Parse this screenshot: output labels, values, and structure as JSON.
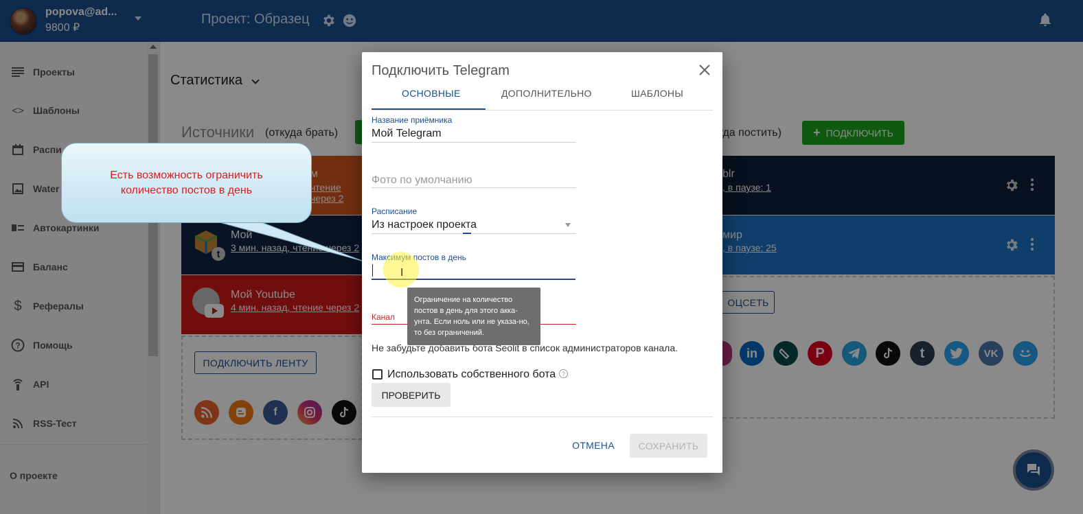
{
  "header": {
    "user_email": "popova@ad...",
    "user_balance": "9800 ₽",
    "project_title": "Проект: Образец"
  },
  "sidebar": {
    "items": [
      {
        "label": "Проекты",
        "icon": "list-icon"
      },
      {
        "label": "Шаблоны",
        "icon": "code-icon"
      },
      {
        "label": "Распи",
        "icon": "calendar-icon"
      },
      {
        "label": "Water",
        "icon": "image-icon"
      },
      {
        "label": "Автокартинки",
        "icon": "autoimage-icon"
      },
      {
        "label": "Баланс",
        "icon": "card-icon"
      },
      {
        "label": "Рефералы",
        "icon": "dollar-icon"
      },
      {
        "label": "Помощь",
        "icon": "help-icon"
      },
      {
        "label": "API",
        "icon": "api-icon"
      },
      {
        "label": "RSS-Тест",
        "icon": "rss-icon"
      }
    ],
    "about": "О проекте"
  },
  "main": {
    "stats_title": "Статистика",
    "sources_title": "Источники",
    "sources_sub": "(откуда брать)",
    "dest_sub": "уда постить)",
    "connect_label": "ПОДКЛЮЧИТЬ",
    "source_cards": [
      {
        "title": "м",
        "sub": "чтение через 2"
      },
      {
        "title": "Мой",
        "sub": "3 мин. назад, чтение через 2"
      },
      {
        "title": "Мой Youtube",
        "sub": "4 мин. назад, чтение через 2"
      }
    ],
    "dest_cards": [
      {
        "title": "blr",
        "sub": ", в паузе: 1"
      },
      {
        "title": "мир",
        "sub": ", в паузе: 25"
      }
    ],
    "connect_feed": "ПОДКЛЮЧИТЬ ЛЕНТУ",
    "connect_social": "ОЦСЕТЬ"
  },
  "dialog": {
    "title": "Подключить Telegram",
    "tabs": [
      "ОСНОВНЫЕ",
      "ДОПОЛНИТЕЛЬНО",
      "ШАБЛОНЫ"
    ],
    "receiver_label": "Название приёмника",
    "receiver_value": "Мой Telegram",
    "photo_placeholder": "Фото по умолчанию",
    "schedule_label": "Расписание",
    "schedule_value": "Из настроек проекта",
    "max_posts_label": "Максимум постов в день",
    "max_posts_value": "",
    "channel_label": "Канал",
    "tooltip": "Ограничение на количество постов в день для этого акка-унта. Если ноль или не указа-но, то без ограничений.",
    "note": "Не забудьте добавить бота Seolit в список администраторов канала.",
    "own_bot_label": "Использовать собственного бота",
    "check_label": "ПРОВЕРИТЬ",
    "cancel_label": "ОТМЕНА",
    "save_label": "СОХРАНИТЬ"
  },
  "callout": {
    "text": "Есть возможность ограничить количество постов в день"
  },
  "colors": {
    "primary": "#1b4f8e",
    "green": "#1ea51e",
    "callout_text": "#d81e1e"
  }
}
